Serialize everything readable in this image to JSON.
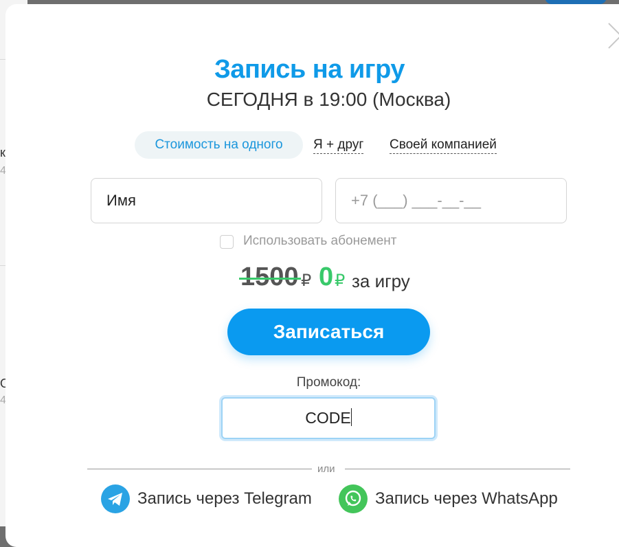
{
  "backdrop": {
    "letters": [
      "к",
      "4",
      "О",
      "4"
    ]
  },
  "modal": {
    "title": "Запись на игру",
    "subtitle": "СЕГОДНЯ в 19:00 (Москва)",
    "tabs": {
      "active": "Стоимость на одного",
      "friend": "Я + друг",
      "company": "Своей компанией"
    },
    "form": {
      "name_placeholder": "Имя",
      "phone_placeholder": "+7 (___) ___-__-__",
      "subscription_label": "Использовать абонемент"
    },
    "price": {
      "old": "1500",
      "currency": "₽",
      "new": "0",
      "suffix": "за игру"
    },
    "submit_label": "Записаться",
    "promo": {
      "label": "Промокод:",
      "value": "CODE"
    },
    "divider_text": "или",
    "social": {
      "telegram_label": "Запись через Telegram",
      "whatsapp_label": "Запись через WhatsApp"
    }
  },
  "colors": {
    "accent": "#0f9ae8",
    "button": "#0a9af0",
    "success": "#38c96a",
    "telegram": "#2aa3e4",
    "whatsapp": "#43c55a"
  },
  "icons": [
    "close-icon",
    "telegram-icon",
    "whatsapp-icon"
  ]
}
